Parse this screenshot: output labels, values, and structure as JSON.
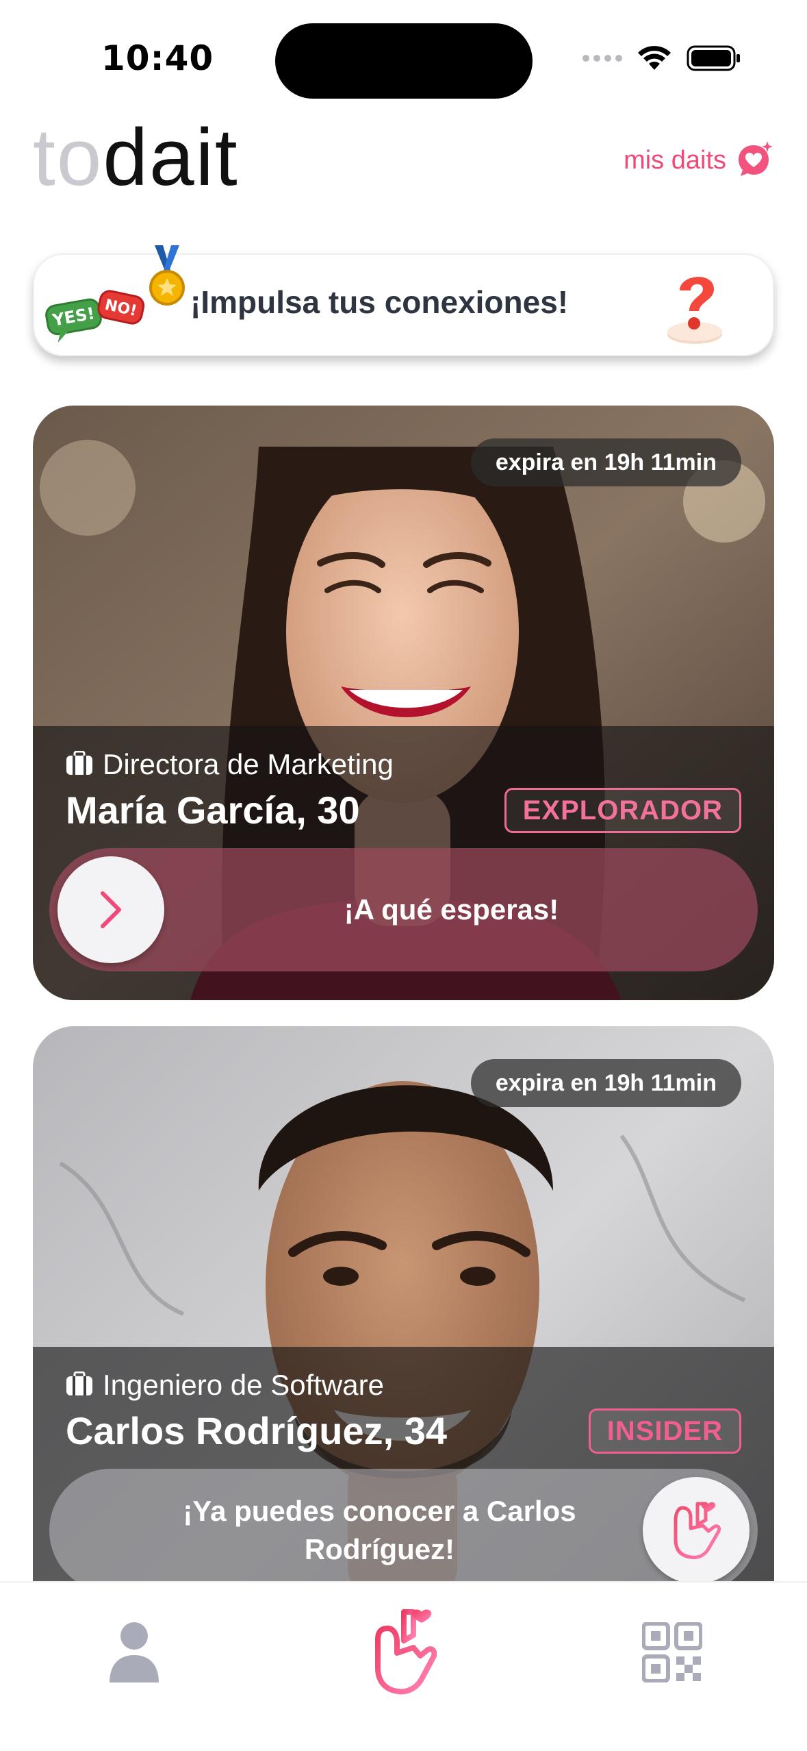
{
  "status_bar": {
    "time": "10:40"
  },
  "header": {
    "logo_part1": "to",
    "logo_part2": "dait",
    "mis_daits_label": "mis daits",
    "mis_daits_icon": "heart-chat-sparkle-icon"
  },
  "boost_banner": {
    "text": "¡Impulsa tus conexiones!",
    "icons": [
      "yes-no-bubbles-icon",
      "medal-icon",
      "question-mark-icon"
    ]
  },
  "cards": [
    {
      "expiry": "expira en 19h 11min",
      "role_icon": "briefcase-icon",
      "role": "Directora de Marketing",
      "name": "María García, 30",
      "level": "EXPLORADOR",
      "action": "¡A qué esperas!",
      "action_icon": "chevron-right-icon"
    },
    {
      "expiry": "expira en 19h 11min",
      "role_icon": "briefcase-icon",
      "role": "Ingeniero de Software",
      "name": "Carlos Rodríguez, 34",
      "level": "INSIDER",
      "action": "¡Ya puedes conocer a Carlos Rodríguez!",
      "action_icon": "finger-heart-icon"
    }
  ],
  "tab_bar": {
    "items": [
      {
        "icon": "person-icon",
        "active": false
      },
      {
        "icon": "finger-heart-icon",
        "active": true
      },
      {
        "icon": "qr-code-icon",
        "active": false
      }
    ]
  },
  "colors": {
    "accent_pink": "#ef4a78",
    "badge_pink": "#f2729c",
    "tab_inactive": "#a9acb8"
  }
}
